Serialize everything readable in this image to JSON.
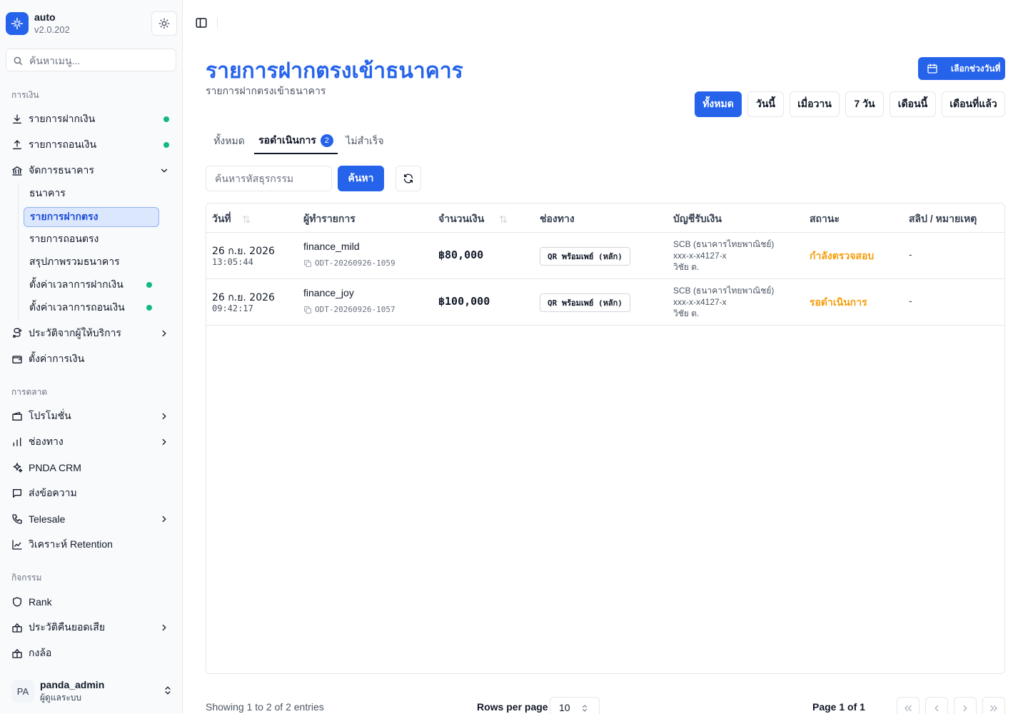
{
  "app": {
    "name": "auto",
    "version": "v2.0.202"
  },
  "menu_search": {
    "placeholder": "ค้นหาเมนู..."
  },
  "sections": {
    "finance": "การเงิน",
    "marketing": "การตลาด",
    "activity": "กิจกรรม"
  },
  "nav": {
    "deposit": "รายการฝากเงิน",
    "withdraw": "รายการถอนเงิน",
    "bank_manage": "จัดการธนาคาร",
    "provider_history": "ประวัติจากผู้ให้บริการ",
    "finance_settings": "ตั้งค่าการเงิน",
    "promotion": "โปรโมชั่น",
    "channel": "ช่องทาง",
    "crm": "PNDA CRM",
    "message": "ส่งข้อความ",
    "telesale": "Telesale",
    "retention": "วิเคราะห์ Retention",
    "rank": "Rank",
    "cashback": "ประวัติคืนยอดเสีย",
    "wheel": "กงล้อ"
  },
  "subnav": {
    "bank": "ธนาคาร",
    "direct_deposit": "รายการฝากตรง",
    "direct_withdraw": "รายการถอนตรง",
    "bank_summary": "สรุปภาพรวมธนาคาร",
    "deposit_time": "ตั้งค่าเวลาการฝากเงิน",
    "withdraw_time": "ตั้งค่าเวลาการถอนเงิน"
  },
  "user": {
    "initials": "PA",
    "name": "panda_admin",
    "role": "ผู้ดูแลระบบ"
  },
  "page": {
    "title": "รายการฝากตรงเข้าธนาคาร",
    "subtitle": "รายการฝากตรงเข้าธนาคาร",
    "date_range_button": "เลือกช่วงวันที่"
  },
  "quick_filters": [
    "ทั้งหมด",
    "วันนี้",
    "เมื่อวาน",
    "7 วัน",
    "เดือนนี้",
    "เดือนที่แล้ว"
  ],
  "quick_filter_active": "ทั้งหมด",
  "tabs": {
    "all": "ทั้งหมด",
    "pending": "รอดำเนินการ",
    "pending_count": "2",
    "failed": "ไม่สำเร็จ"
  },
  "search": {
    "placeholder": "ค้นหารหัสธุรกรรม",
    "button": "ค้นหา"
  },
  "table": {
    "headers": {
      "date": "วันที่",
      "user": "ผู้ทำรายการ",
      "amount": "จำนวนเงิน",
      "channel": "ช่องทาง",
      "account": "บัญชีรับเงิน",
      "status": "สถานะ",
      "note": "สลิป / หมายเหตุ"
    },
    "rows": [
      {
        "date": "26 ก.ย. 2026",
        "time": "13:05:44",
        "user": "finance_mild",
        "ref": "ODT-20260926-1059",
        "amount": "฿80,000",
        "channel": "QR พร้อมเพย์ (หลัก)",
        "bank": "SCB (ธนาคารไทยพาณิชย์)",
        "account_no": "xxx-x-x4127-x",
        "account_name": "วิชัย ต.",
        "status": "กำลังตรวจสอบ",
        "note": "-"
      },
      {
        "date": "26 ก.ย. 2026",
        "time": "09:42:17",
        "user": "finance_joy",
        "ref": "ODT-20260926-1057",
        "amount": "฿100,000",
        "channel": "QR พร้อมเพย์ (หลัก)",
        "bank": "SCB (ธนาคารไทยพาณิชย์)",
        "account_no": "xxx-x-x4127-x",
        "account_name": "วิชัย ต.",
        "status": "รอดำเนินการ",
        "note": "-"
      }
    ]
  },
  "pagination": {
    "info": "Showing 1 to 2 of 2 entries",
    "rows_per_page_label": "Rows per page",
    "rows_per_page": "10",
    "page_label": "Page 1 of 1"
  },
  "colors": {
    "accent": "#2563eb",
    "status_warning": "#f59e0b",
    "online_dot": "#10b981"
  }
}
